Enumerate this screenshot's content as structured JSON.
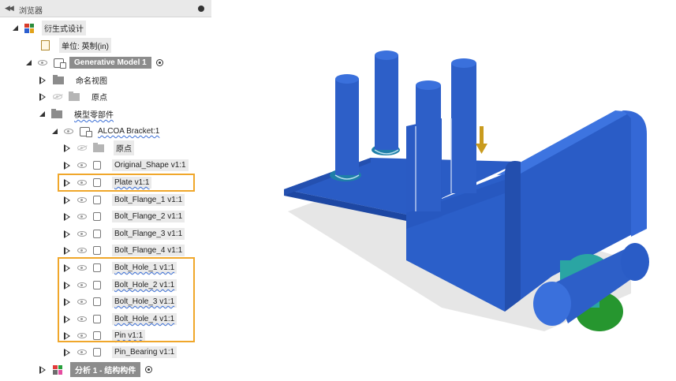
{
  "browser": {
    "title": "浏览器",
    "collapse_icon": "double-chevron-left-icon",
    "menu_icon": "options-dot-icon"
  },
  "tree": {
    "root_label": "衍生式设计",
    "units_label": "单位: 英制(in)",
    "model_label": "Generative Model 1",
    "named_views_label": "命名视图",
    "origin_label": "原点",
    "model_components_label": "模型零部件",
    "bracket_label": "ALCOA Bracket:1",
    "bracket_origin_label": "原点",
    "bodies": [
      "Original_Shape v1:1",
      "Plate v1:1",
      "Bolt_Flange_1 v1:1",
      "Bolt_Flange_2 v1:1",
      "Bolt_Flange_3 v1:1",
      "Bolt_Flange_4 v1:1",
      "Bolt_Hole_1 v1:1",
      "Bolt_Hole_2 v1:1",
      "Bolt_Hole_3 v1:1",
      "Bolt_Hole_4 v1:1",
      "Pin v1:1",
      "Pin_Bearing v1:1"
    ],
    "analysis_label": "分析 1 - 结构构件"
  },
  "colors": {
    "highlight": "#f0a72b",
    "model_blue": "#2d5fc8",
    "bearing_teal": "#2aa5a3",
    "bearing_green": "#26962f",
    "load_arrow": "#c99b1e"
  }
}
